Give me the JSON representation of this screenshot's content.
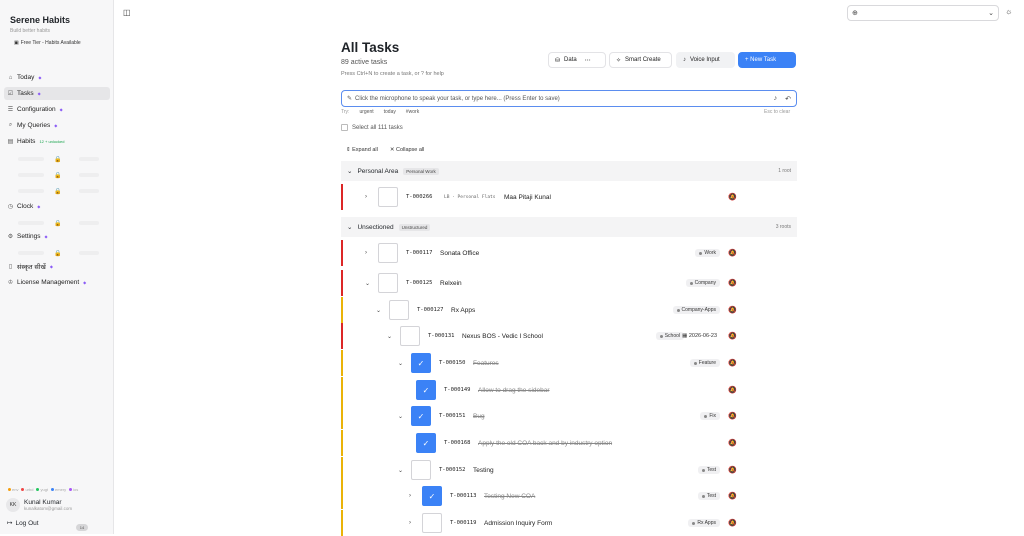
{
  "app": {
    "name": "Serene Habits",
    "tagline": "Build better habits",
    "tier": "Free Tier - Habits Available"
  },
  "nav": [
    {
      "label": "Today",
      "icon": "home-icon"
    },
    {
      "label": "Tasks",
      "icon": "tasks-icon",
      "active": true
    },
    {
      "label": "Configuration",
      "icon": "config-icon"
    },
    {
      "label": "My Queries",
      "icon": "query-icon"
    },
    {
      "label": "Habits",
      "icon": "habits-icon",
      "extra": "12 + unlocked"
    }
  ],
  "nav2": [
    {
      "label": "Clock",
      "icon": "clock-icon"
    },
    {
      "label": "Settings",
      "icon": "gear-icon"
    },
    {
      "label": "संस्कृत सीखें",
      "icon": "book-icon"
    },
    {
      "label": "License Management",
      "icon": "license-icon"
    }
  ],
  "legend": [
    "env",
    "urbd",
    "yugt",
    "emery",
    "ios"
  ],
  "user": {
    "initials": "KK",
    "name": "Kunal Kumar",
    "email": "kunalkatom@gmail.com",
    "logout": "Log Out",
    "badge": "14"
  },
  "header": {
    "title": "All Tasks",
    "subtitle": "89 active tasks",
    "hint": "Press Ctrl+N to create a task, or ? for help",
    "data_btn": "Data",
    "smart_btn": "Smart Create",
    "voice_btn": "Voice Input",
    "new_btn": "+   New Task"
  },
  "input": {
    "placeholder": "Click the microphone to speak your task, or type here... (Press Enter to save)"
  },
  "try": {
    "label": "Try:",
    "chips": [
      "urgent",
      "today",
      "#work"
    ],
    "esc": "Esc to clear"
  },
  "select_all": "Select all 111 tasks",
  "expand": "Expand all",
  "collapse": "Collapse all",
  "sections": [
    {
      "name": "Personal Area",
      "tag": "Personal Work",
      "count": "1 root"
    },
    {
      "name": "Unsectioned",
      "tag": "Unstructured",
      "count": "3 roots"
    }
  ],
  "tasks": [
    {
      "id": "T-000266",
      "crumb": "LB · Personal Flats",
      "title": "Maa Pitaji Kunal",
      "done": false,
      "badge": "",
      "date": "",
      "accent": "#dc2626"
    },
    {
      "id": "T-000117",
      "title": "Sonata Office",
      "done": false,
      "badge": "Work",
      "date": "",
      "accent": "#dc2626"
    },
    {
      "id": "T-000125",
      "title": "Relxein",
      "done": false,
      "badge": "Company",
      "date": "",
      "accent": "#dc2626"
    },
    {
      "id": "T-000127",
      "title": "Rx Apps",
      "done": false,
      "badge": "Company-Apps",
      "date": "",
      "accent": "#eab308"
    },
    {
      "id": "T-000131",
      "title": "Nexus BOS - Vedic I School",
      "done": false,
      "badge": "School",
      "date": "2026-06-23",
      "accent": "#dc2626"
    },
    {
      "id": "T-000150",
      "title": "Features",
      "done": true,
      "badge": "Feature",
      "date": "",
      "accent": "#eab308"
    },
    {
      "id": "T-000149",
      "title": "Allow to drag the sidebar",
      "done": true,
      "badge": "",
      "date": "",
      "accent": "#eab308"
    },
    {
      "id": "T-000151",
      "title": "Bug",
      "done": true,
      "badge": "Fix",
      "date": "",
      "accent": "#eab308"
    },
    {
      "id": "T-000168",
      "title": "Apply the old COA back and by industry option",
      "done": true,
      "badge": "",
      "date": "",
      "accent": "#eab308"
    },
    {
      "id": "T-000152",
      "title": "Testing",
      "done": false,
      "badge": "Test",
      "date": "",
      "accent": "#eab308"
    },
    {
      "id": "T-000113",
      "title": "Testing New COA",
      "done": true,
      "badge": "Test",
      "date": "",
      "accent": "#eab308"
    },
    {
      "id": "T-000119",
      "title": "Admission Inquiry Form",
      "done": false,
      "badge": "Rx Apps",
      "date": "",
      "accent": "#eab308"
    }
  ]
}
